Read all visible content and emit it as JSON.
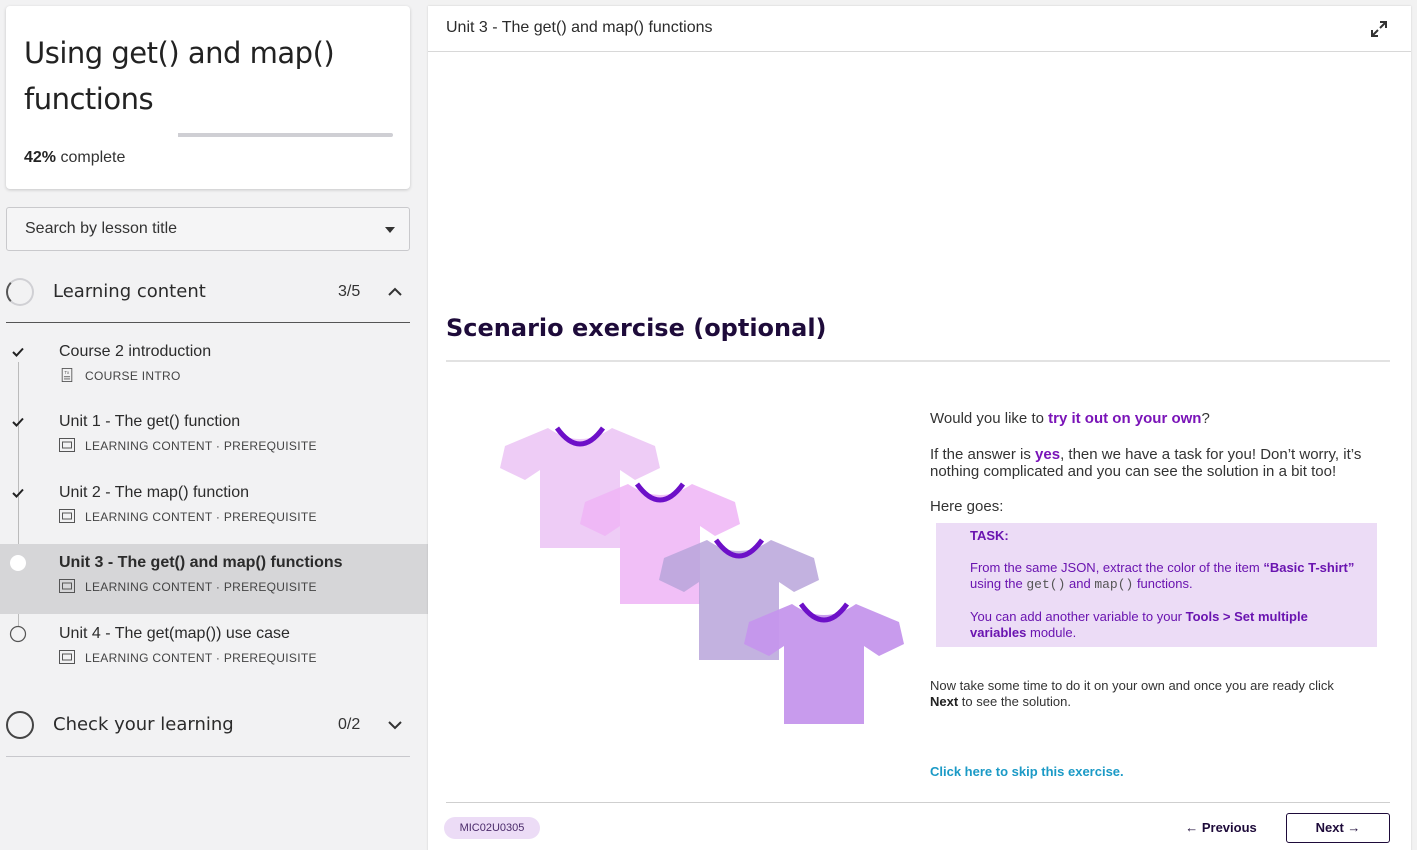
{
  "course": {
    "title": "Using get() and map() functions",
    "progress_percent": "42%",
    "progress_suffix": " complete",
    "progress_value": 0.42
  },
  "search": {
    "placeholder": "Search by lesson title"
  },
  "sections": [
    {
      "title": "Learning content",
      "count": "3/5",
      "expanded": true
    },
    {
      "title": "Check your learning",
      "count": "0/2",
      "expanded": false
    }
  ],
  "lessons": [
    {
      "title": "Course 2 introduction",
      "meta": "COURSE INTRO",
      "status": "done",
      "icon": "document-icon"
    },
    {
      "title": "Unit 1 - The get() function",
      "meta": "LEARNING CONTENT · PREREQUISITE",
      "status": "done",
      "icon": "slides-icon"
    },
    {
      "title": "Unit 2 - The map() function",
      "meta": "LEARNING CONTENT · PREREQUISITE",
      "status": "done",
      "icon": "slides-icon"
    },
    {
      "title": "Unit 3 - The get() and map() functions",
      "meta": "LEARNING CONTENT · PREREQUISITE",
      "status": "current",
      "icon": "slides-icon"
    },
    {
      "title": "Unit 4 - The get(map()) use case",
      "meta": "LEARNING CONTENT · PREREQUISITE",
      "status": "todo",
      "icon": "slides-icon"
    }
  ],
  "main": {
    "header_title": "Unit 3 - The get() and map() functions",
    "scenario_title": "Scenario exercise  (optional)",
    "q_prefix": "Would you like to ",
    "q_accent": "try it out on your own",
    "q_suffix": "?",
    "a_prefix": "If the answer is ",
    "a_accent": "yes",
    "a_suffix": ", then we have a task for you! Don’t worry, it’s nothing complicated and you can see the solution in a bit too!",
    "here_goes": "Here goes:",
    "task": {
      "label": "TASK:",
      "line1_prefix": "From the same JSON, extract the color of the item ",
      "line1_item": "“Basic T-shirt”",
      "line1_mid": " using the ",
      "code1": "get()",
      "and_word": " and ",
      "code2": "map()",
      "line1_suffix": " functions.",
      "line2_prefix": "You can add another variable to your ",
      "line2_bold": "Tools > Set multiple variables",
      "line2_suffix": " module."
    },
    "closing_prefix": "Now take some time to do it on your own and once you are ready click ",
    "closing_bold": "Next",
    "closing_suffix": " to see the solution.",
    "skip_link": "Click here to skip this exercise.",
    "code_badge": "MIC02U0305",
    "prev_label": "← Previous",
    "next_label": "Next →"
  },
  "colors": {
    "accent_purple": "#7a14b8",
    "link_blue": "#1b9ac6",
    "shirt_1": "#ecc6f5",
    "shirt_2": "#efb4f6",
    "shirt_3": "#c4b0e0",
    "shirt_4": "#c89cec",
    "collar": "#6d10c8"
  }
}
